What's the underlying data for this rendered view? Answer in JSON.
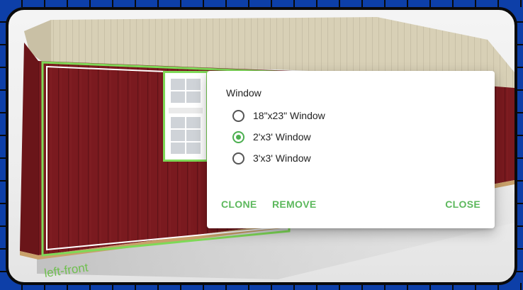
{
  "dialog": {
    "title": "Window",
    "options": [
      {
        "label": "18\"x23\" Window",
        "selected": false
      },
      {
        "label": "2'x3' Window",
        "selected": true
      },
      {
        "label": "3'x3' Window",
        "selected": false
      }
    ],
    "actions": {
      "clone": "CLONE",
      "remove": "REMOVE",
      "close": "CLOSE"
    }
  },
  "scene": {
    "wall_label": "left-front",
    "colors": {
      "siding": "#7a1a1f",
      "roof": "#d9d2b8",
      "trim": "#ffffff",
      "selection": "#7ed957",
      "accent": "#5cb85c",
      "frame": "#0d3fa8"
    }
  }
}
